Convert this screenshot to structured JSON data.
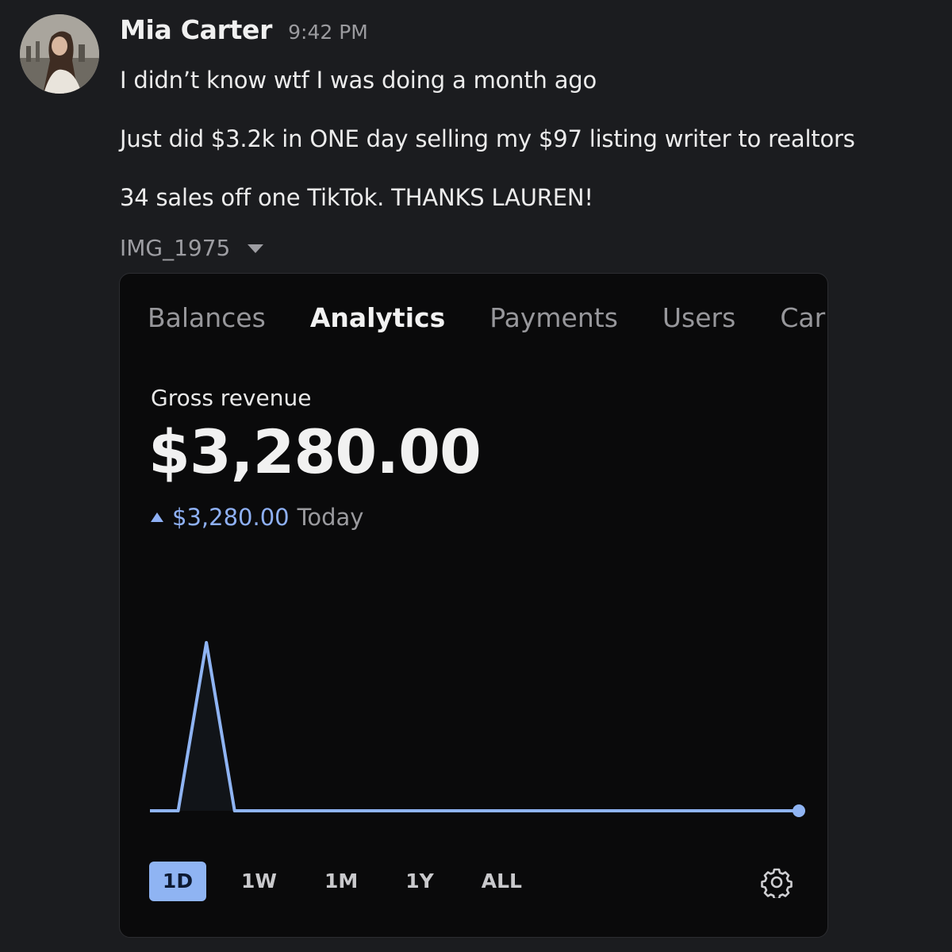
{
  "message": {
    "author": "Mia Carter",
    "time": "9:42 PM",
    "lines": [
      "I didn’t know wtf I was doing a month ago",
      "Just did $3.2k in ONE day selling my $97 listing writer to realtors",
      "34 sales off one TikTok. THANKS LAUREN!"
    ],
    "attachment": {
      "name": "IMG_1975",
      "icon": "chevron-down-icon"
    }
  },
  "dashboard": {
    "tabs": [
      "Balances",
      "Analytics",
      "Payments",
      "Users",
      "Car"
    ],
    "active_tab": "Analytics",
    "metric": {
      "label": "Gross revenue",
      "value": "$3,280.00",
      "change_amount": "$3,280.00",
      "change_period": "Today",
      "change_icon": "triangle-up-icon"
    },
    "ranges": [
      "1D",
      "1W",
      "1M",
      "1Y",
      "ALL"
    ],
    "active_range": "1D",
    "settings_icon": "gear-icon",
    "accent_color": "#8fb4f3"
  },
  "chart_data": {
    "type": "line",
    "values": [
      0,
      0,
      3280,
      0,
      0,
      0,
      0,
      0,
      0,
      0,
      0,
      0,
      0,
      0,
      0,
      0,
      0,
      0,
      0,
      0,
      0,
      0,
      0,
      0
    ],
    "ylim": [
      0,
      3280
    ],
    "grid": false,
    "color": "#8fb4f3"
  }
}
